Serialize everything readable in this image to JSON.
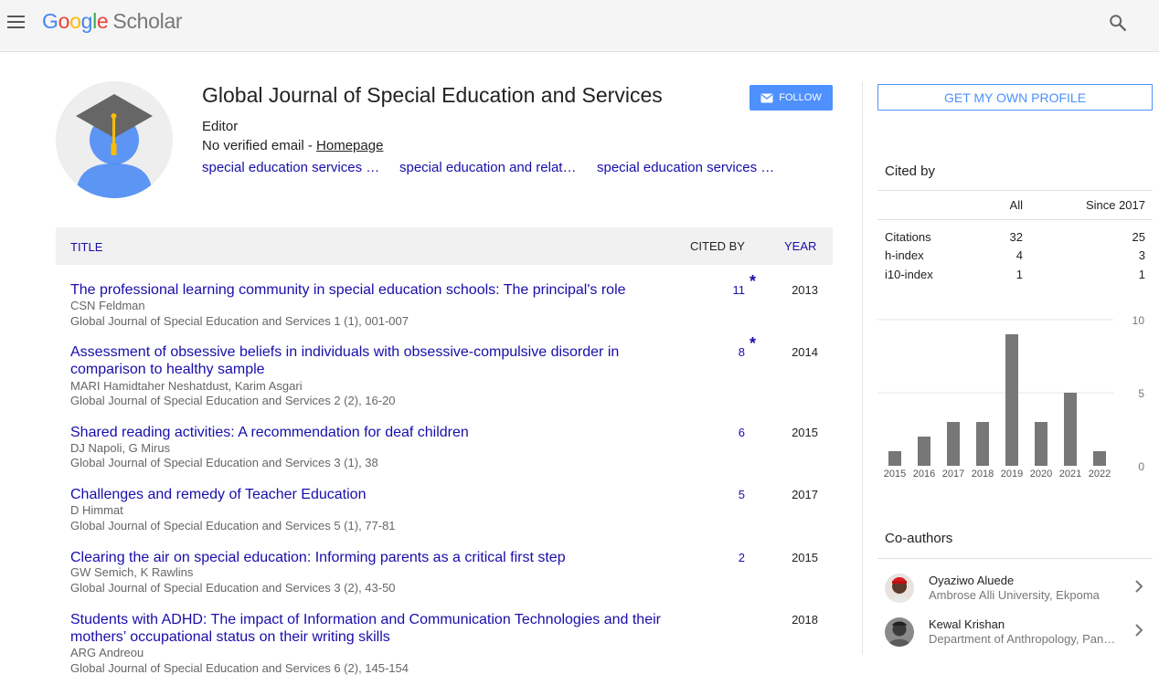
{
  "header": {
    "logo": {
      "g1": "G",
      "g2": "o",
      "g3": "o",
      "g4": "g",
      "g5": "l",
      "g6": "e",
      "scholar": "Scholar"
    }
  },
  "profile": {
    "name": "Global Journal of Special Education and Services",
    "affiliation": "Editor",
    "email_text": "No verified email - ",
    "homepage_label": "Homepage",
    "interests": [
      "special education services a…",
      "special education and relate…",
      "special education services c…"
    ],
    "follow_label": "FOLLOW"
  },
  "table": {
    "col_title": "TITLE",
    "col_cited": "CITED BY",
    "col_year": "YEAR",
    "rows": [
      {
        "title": "The professional learning community in special education schools: The principal's role",
        "authors": "CSN Feldman",
        "venue": "Global Journal of Special Education and Services 1 (1), 001-007",
        "cited": "11",
        "star": "*",
        "year": "2013"
      },
      {
        "title": "Assessment of obsessive beliefs in individuals with obsessive-compulsive disorder in comparison to healthy sample",
        "authors": "MARI Hamidtaher Neshatdust, Karim Asgari",
        "venue": "Global Journal of Special Education and Services 2 (2), 16-20",
        "cited": "8",
        "star": "*",
        "year": "2014"
      },
      {
        "title": "Shared reading activities: A recommendation for deaf children",
        "authors": "DJ Napoli, G Mirus",
        "venue": "Global Journal of Special Education and Services 3 (1), 38",
        "cited": "6",
        "star": "",
        "year": "2015"
      },
      {
        "title": "Challenges and remedy of Teacher Education",
        "authors": "D Himmat",
        "venue": "Global Journal of Special Education and Services 5 (1), 77-81",
        "cited": "5",
        "star": "",
        "year": "2017"
      },
      {
        "title": "Clearing the air on special education: Informing parents as a critical first step",
        "authors": "GW Semich, K Rawlins",
        "venue": "Global Journal of Special Education and Services 3 (2), 43-50",
        "cited": "2",
        "star": "",
        "year": "2015"
      },
      {
        "title": "Students with ADHD: The impact of Information and Communication Technologies and their mothers’ occupational status on their writing skills",
        "authors": "ARG Andreou",
        "venue": "Global Journal of Special Education and Services 6 (2), 145-154",
        "cited": "",
        "star": "",
        "year": "2018"
      }
    ]
  },
  "sidebar": {
    "own_profile_label": "GET MY OWN PROFILE",
    "cited_by_title": "Cited by",
    "stats_header": {
      "all": "All",
      "since": "Since 2017"
    },
    "stats": [
      {
        "label": "Citations",
        "all": "32",
        "since": "25"
      },
      {
        "label": "h-index",
        "all": "4",
        "since": "3"
      },
      {
        "label": "i10-index",
        "all": "1",
        "since": "1"
      }
    ],
    "coauthors_title": "Co-authors",
    "coauthors": [
      {
        "name": "Oyaziwo Aluede",
        "affiliation": "Ambrose Alli University, Ekpoma"
      },
      {
        "name": "Kewal Krishan",
        "affiliation": "Department of Anthropology, Pan…"
      }
    ]
  },
  "colors": {
    "link": "#1a0dab",
    "button": "#4d90fe",
    "bar": "#777777"
  },
  "chart_data": {
    "type": "bar",
    "categories": [
      "2015",
      "2016",
      "2017",
      "2018",
      "2019",
      "2020",
      "2021",
      "2022"
    ],
    "values": [
      1,
      2,
      3,
      3,
      9,
      3,
      5,
      1
    ],
    "yticks": [
      "0",
      "5",
      "10"
    ],
    "ylim": [
      0,
      10
    ],
    "grid": true
  }
}
